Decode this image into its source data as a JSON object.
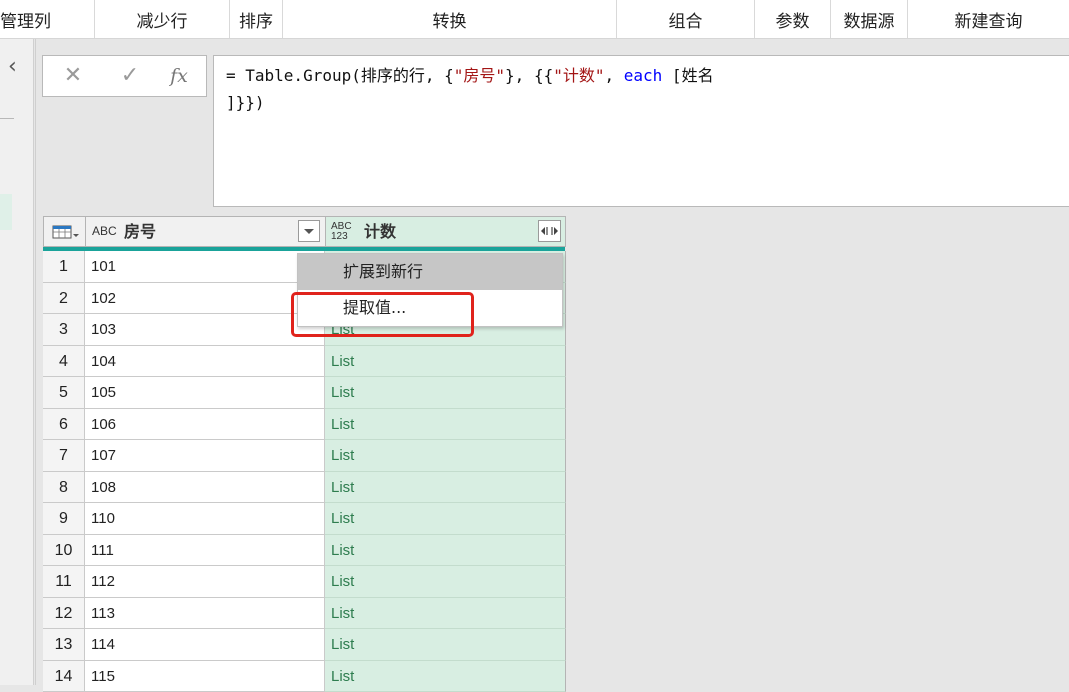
{
  "ribbon": {
    "groups": [
      "管理列",
      "减少行",
      "排序",
      "转换",
      "组合",
      "参数",
      "数据源",
      "新建查询"
    ]
  },
  "formula_bar": {
    "cancel_icon": "✕",
    "commit_icon": "✓",
    "fx_label": "fx",
    "line1": {
      "prefix": "= Table.Group(排序的行, {",
      "str1": "\"房号\"",
      "mid": "}, {{",
      "str2": "\"计数\"",
      "comma": ", ",
      "kw": "each",
      "suffix": " [姓名"
    },
    "line2": "]}})"
  },
  "table": {
    "col1_type": "ABC",
    "col1_name": "房号",
    "col2_type_top": "ABC",
    "col2_type_bottom": "123",
    "col2_name": "计数",
    "rows": [
      {
        "n": "1",
        "room": "101",
        "count": ""
      },
      {
        "n": "2",
        "room": "102",
        "count": ""
      },
      {
        "n": "3",
        "room": "103",
        "count": "List"
      },
      {
        "n": "4",
        "room": "104",
        "count": "List"
      },
      {
        "n": "5",
        "room": "105",
        "count": "List"
      },
      {
        "n": "6",
        "room": "106",
        "count": "List"
      },
      {
        "n": "7",
        "room": "107",
        "count": "List"
      },
      {
        "n": "8",
        "room": "108",
        "count": "List"
      },
      {
        "n": "9",
        "room": "110",
        "count": "List"
      },
      {
        "n": "10",
        "room": "111",
        "count": "List"
      },
      {
        "n": "11",
        "room": "112",
        "count": "List"
      },
      {
        "n": "12",
        "room": "113",
        "count": "List"
      },
      {
        "n": "13",
        "room": "114",
        "count": "List"
      },
      {
        "n": "14",
        "room": "115",
        "count": "List"
      }
    ]
  },
  "expand_menu": {
    "items": [
      "扩展到新行",
      "提取值..."
    ]
  },
  "colors": {
    "accent_teal": "#1aa39a",
    "list_column_bg": "#d8eee2",
    "highlight_red": "#e0231c"
  }
}
